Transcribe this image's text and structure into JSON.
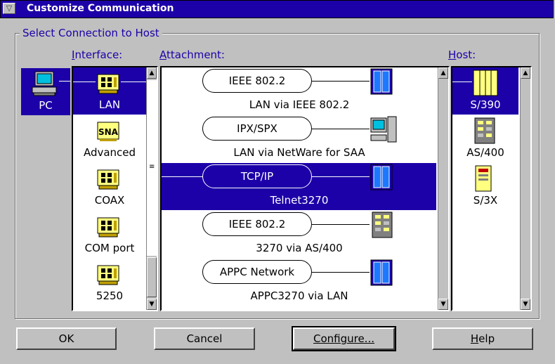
{
  "window": {
    "title": "Customize Communication"
  },
  "group": {
    "label": "Select Connection to Host"
  },
  "labels": {
    "interface": "Interface:",
    "attachment": "Attachment:",
    "host": "Host:"
  },
  "pc": {
    "label": "PC"
  },
  "interfaces": [
    {
      "label": "LAN",
      "icon": "lan-adapter-icon",
      "selected": true
    },
    {
      "label": "Advanced",
      "icon": "sna-icon",
      "selected": false
    },
    {
      "label": "COAX",
      "icon": "coax-adapter-icon",
      "selected": false
    },
    {
      "label": "COM port",
      "icon": "com-port-adapter-icon",
      "selected": false
    },
    {
      "label": "5250",
      "icon": "5250-adapter-icon",
      "selected": false
    }
  ],
  "attachments": [
    {
      "protocol": "IEEE 802.2",
      "label": "LAN via IEEE 802.2",
      "icon": "s390-host-icon",
      "selected": false
    },
    {
      "protocol": "IPX/SPX",
      "label": "LAN via NetWare for SAA",
      "icon": "netware-server-icon",
      "selected": false
    },
    {
      "protocol": "TCP/IP",
      "label": "Telnet3270",
      "icon": "s390-host-icon",
      "selected": true
    },
    {
      "protocol": "IEEE 802.2",
      "label": "3270 via AS/400",
      "icon": "as400-host-icon",
      "selected": false
    },
    {
      "protocol": "APPC Network",
      "label": "APPC3270 via LAN",
      "icon": "s390-host-icon",
      "selected": false
    }
  ],
  "hosts": [
    {
      "label": "S/390",
      "icon": "s390-host-icon",
      "selected": true
    },
    {
      "label": "AS/400",
      "icon": "as400-host-icon",
      "selected": false
    },
    {
      "label": "S/3X",
      "icon": "s3x-host-icon",
      "selected": false
    }
  ],
  "buttons": {
    "ok": "OK",
    "cancel": "Cancel",
    "configure": "Configure...",
    "help": "Help"
  },
  "colors": {
    "selection": "#1c00a8",
    "title_bar": "#1c00a8",
    "face": "#c0c0c0"
  }
}
